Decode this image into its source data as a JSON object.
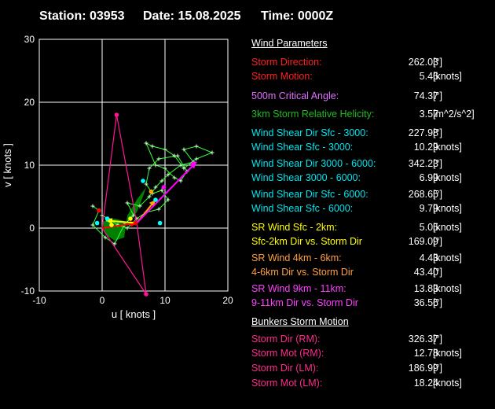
{
  "header": {
    "station": "Station: 03953",
    "date": "Date: 15.08.2025",
    "time": "Time: 0000Z"
  },
  "chart_data": {
    "type": "scatter",
    "xlabel": "u  [ knots ]",
    "ylabel": "v  [ knots ]",
    "xlim": [
      -10,
      20
    ],
    "ylim": [
      -10,
      30
    ],
    "xticks": [
      "-10",
      "0",
      "10",
      "20"
    ],
    "yticks": [
      "-10",
      "0",
      "10",
      "20",
      "30"
    ],
    "grid": true,
    "hodograph": {
      "color": "#33ff33",
      "points": [
        [
          -1.5,
          3.5
        ],
        [
          -0.5,
          2.8
        ],
        [
          -1.5,
          0.5
        ],
        [
          0.5,
          -1.5
        ],
        [
          2,
          -2.5
        ],
        [
          3.5,
          0.5
        ],
        [
          5,
          2
        ],
        [
          4,
          4
        ],
        [
          6,
          3.5
        ],
        [
          7.5,
          5
        ],
        [
          8.5,
          6.5
        ],
        [
          9.5,
          7.5
        ],
        [
          10.5,
          8.5
        ],
        [
          12.5,
          10
        ],
        [
          14.5,
          10.5
        ],
        [
          13,
          12.5
        ],
        [
          15,
          13
        ],
        [
          17.5,
          12
        ],
        [
          15,
          11
        ],
        [
          13,
          9.5
        ],
        [
          11.5,
          11.5
        ],
        [
          10,
          12.5
        ],
        [
          8,
          13
        ],
        [
          7,
          13.5
        ],
        [
          8.5,
          10
        ],
        [
          10,
          9.5
        ],
        [
          11.5,
          8
        ],
        [
          12.5,
          7.5
        ],
        [
          13.5,
          9
        ],
        [
          12,
          11.5
        ],
        [
          9,
          11
        ],
        [
          7.5,
          9.5
        ],
        [
          7,
          7
        ],
        [
          8,
          5.5
        ],
        [
          9.5,
          6
        ],
        [
          10.5,
          4.5
        ],
        [
          9,
          3
        ],
        [
          7,
          2.5
        ],
        [
          5.5,
          1.5
        ],
        [
          4,
          0
        ],
        [
          2.5,
          0.5
        ],
        [
          1,
          1.5
        ],
        [
          0,
          2
        ]
      ]
    },
    "shaded_area": {
      "color": "#008000",
      "points": [
        [
          0,
          1
        ],
        [
          2,
          1.5
        ],
        [
          4,
          1
        ],
        [
          5.5,
          2.5
        ],
        [
          6.5,
          5
        ],
        [
          7,
          6.5
        ],
        [
          5.5,
          4.5
        ],
        [
          4,
          2
        ],
        [
          3.5,
          -1.5
        ],
        [
          2,
          -2
        ],
        [
          0.5,
          -1
        ],
        [
          0,
          1
        ]
      ]
    },
    "arrows": [
      {
        "name": "Storm Motion",
        "color": "#ff0000",
        "from": [
          0,
          0
        ],
        "to": [
          5.5,
          0.8
        ]
      },
      {
        "name": "SR Wind Sfc - 2km",
        "color": "#ffff00",
        "from": [
          5.5,
          0.8
        ],
        "to": [
          0.6,
          1.2
        ]
      },
      {
        "name": "SR Wind 4km - 6km",
        "color": "#ffa500",
        "from": [
          5.5,
          0.8
        ],
        "to": [
          8.5,
          4.5
        ]
      },
      {
        "name": "SR Wind 9km - 11km",
        "color": "#ff00ff",
        "from": [
          5.5,
          0.8
        ],
        "to": [
          15,
          10.5
        ]
      }
    ],
    "bunkers_lines": {
      "color": "#ff1493",
      "lines": [
        [
          [
            0,
            0
          ],
          [
            2.3,
            18
          ]
        ],
        [
          [
            2.3,
            18
          ],
          [
            5.5,
            0.8
          ]
        ],
        [
          [
            0,
            0
          ],
          [
            7,
            -10.5
          ]
        ],
        [
          [
            7,
            -10.5
          ],
          [
            5.5,
            0.8
          ]
        ]
      ],
      "points": [
        [
          2.3,
          18
        ],
        [
          7,
          -10.5
        ]
      ]
    },
    "markers": [
      {
        "color": "#00ffff",
        "points": [
          [
            -0.8,
            0.8
          ],
          [
            9.2,
            0.8
          ],
          [
            6.5,
            7.5
          ],
          [
            8.5,
            4.5
          ],
          [
            0.8,
            1.5
          ]
        ]
      },
      {
        "color": "#ffff00",
        "points": [
          [
            1.5,
            0.5
          ],
          [
            4.5,
            1.5
          ]
        ]
      },
      {
        "color": "#ffa500",
        "points": [
          [
            7.8,
            5.8
          ]
        ]
      },
      {
        "color": "#ff00ff",
        "points": [
          [
            14.5,
            10.2
          ],
          [
            9.8,
            6.5
          ]
        ]
      },
      {
        "color": "#ff0000",
        "points": [
          [
            5.3,
            0.8
          ],
          [
            -0.5,
            2.8
          ]
        ]
      },
      {
        "color": "#ff1493",
        "points": [
          [
            2.3,
            18
          ],
          [
            7,
            -10.5
          ]
        ]
      }
    ]
  },
  "params": {
    "sections": {
      "wind": "Wind Parameters",
      "bunkers": "Bunkers Storm Motion"
    },
    "rows": [
      {
        "label": "Storm Direction:",
        "value": "262.03",
        "unit": "[°]",
        "color": "#ff2020"
      },
      {
        "label": "Storm Motion:",
        "value": "5.46",
        "unit": "[knots]",
        "color": "#ff2020"
      },
      {
        "label": "500m Critical Angle:",
        "value": "74.37",
        "unit": "[°]",
        "color": "#e070ff"
      },
      {
        "label": "3km Storm Relative Helicity:",
        "value": "3.57",
        "unit": "[m^2/s^2]",
        "color": "#22bb22"
      },
      {
        "label": "Wind Shear Dir Sfc - 3000:",
        "value": "227.98",
        "unit": "[°]",
        "color": "#00e5ee"
      },
      {
        "label": "Wind Shear Sfc - 3000:",
        "value": "10.29",
        "unit": "[knots]",
        "color": "#00e5ee"
      },
      {
        "label": "Wind Shear Dir 3000 - 6000:",
        "value": "342.23",
        "unit": "[°]",
        "color": "#00e5ee"
      },
      {
        "label": "Wind Shear 3000 - 6000:",
        "value": "6.99",
        "unit": "[knots]",
        "color": "#00e5ee"
      },
      {
        "label": "Wind Shear Dir Sfc - 6000:",
        "value": "268.65",
        "unit": "[°]",
        "color": "#00e5ee"
      },
      {
        "label": "Wind Shear Sfc - 6000:",
        "value": "9.79",
        "unit": "[knots]",
        "color": "#00e5ee"
      },
      {
        "label": "SR Wind Sfc - 2km:",
        "value": "5.05",
        "unit": "[knots]",
        "color": "#ffff00"
      },
      {
        "label": "Sfc-2km Dir vs. Storm Dir",
        "value": "169.09",
        "unit": "[°]",
        "color": "#ffff00"
      },
      {
        "label": "SR Wind 4km - 6km:",
        "value": "4.43",
        "unit": "[knots]",
        "color": "#ffa040"
      },
      {
        "label": "4-6km Dir vs. Storm Dir",
        "value": "43.40",
        "unit": "[°]",
        "color": "#ffa040"
      },
      {
        "label": "SR Wind 9km - 11km:",
        "value": "13.83",
        "unit": "[knots]",
        "color": "#ff40ff"
      },
      {
        "label": "9-11km Dir vs. Storm Dir",
        "value": "36.56",
        "unit": "[°]",
        "color": "#ff40ff"
      },
      {
        "label": "Storm Dir (RM):",
        "value": "326.37",
        "unit": "[°]",
        "color": "#ff2a8a"
      },
      {
        "label": "Storm Mot (RM):",
        "value": "12.78",
        "unit": "[knots]",
        "color": "#ff2a8a"
      },
      {
        "label": "Storm Dir (LM):",
        "value": "186.99",
        "unit": "[°]",
        "color": "#ff2a8a"
      },
      {
        "label": "Storm Mot (LM):",
        "value": "18.24",
        "unit": "[knots]",
        "color": "#ff2a8a"
      }
    ]
  }
}
